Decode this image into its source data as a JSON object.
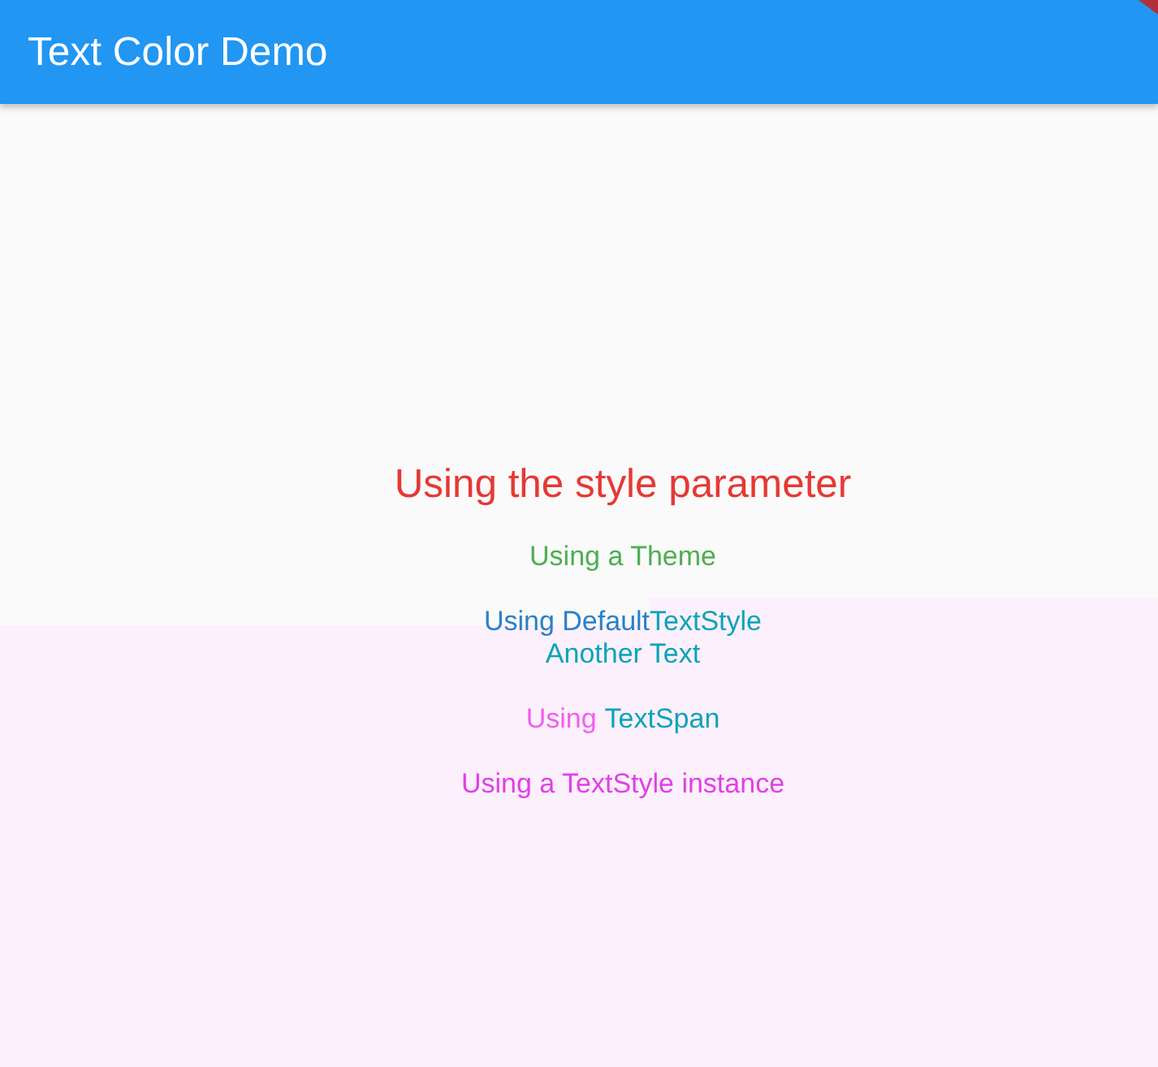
{
  "app_bar": {
    "title": "Text Color Demo"
  },
  "sections": [
    {
      "lines": [
        {
          "kind": "large",
          "parts": [
            {
              "text": "Using the style parameter",
              "color": "#e53935"
            }
          ]
        }
      ]
    },
    {
      "lines": [
        {
          "kind": "normal",
          "parts": [
            {
              "text": "Using a Theme",
              "color": "#4caf50"
            }
          ]
        }
      ]
    },
    {
      "lines": [
        {
          "kind": "normal",
          "parts": [
            {
              "text": "Using Default",
              "color": "#2a80c8"
            },
            {
              "text": "TextStyle",
              "color": "#0aa4b8"
            }
          ]
        },
        {
          "kind": "normal",
          "parts": [
            {
              "text": "Another Text",
              "color": "#0aa4b8"
            }
          ]
        }
      ]
    },
    {
      "lines": [
        {
          "kind": "spaced",
          "parts": [
            {
              "text": "Using",
              "color": "#f060f0"
            },
            {
              "text": "TextSpan",
              "color": "#0aa4b8"
            }
          ]
        }
      ]
    },
    {
      "lines": [
        {
          "kind": "normal",
          "parts": [
            {
              "text": "Using a TextStyle instance",
              "color": "#e040e8"
            }
          ]
        }
      ]
    }
  ]
}
